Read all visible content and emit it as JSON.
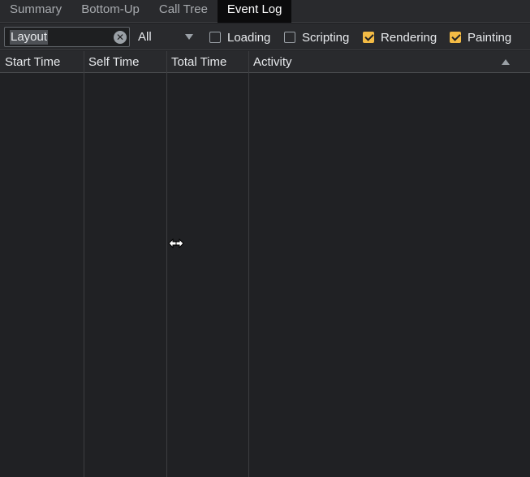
{
  "tabs": [
    {
      "label": "Summary"
    },
    {
      "label": "Bottom-Up"
    },
    {
      "label": "Call Tree"
    },
    {
      "label": "Event Log"
    }
  ],
  "active_tab": "Event Log",
  "toolbar": {
    "filter_value": "Layout",
    "duration_select": "All",
    "checkboxes": [
      {
        "label": "Loading",
        "checked": false
      },
      {
        "label": "Scripting",
        "checked": false
      },
      {
        "label": "Rendering",
        "checked": true
      },
      {
        "label": "Painting",
        "checked": true
      }
    ]
  },
  "grid": {
    "columns": [
      {
        "label": "Start Time"
      },
      {
        "label": "Self Time"
      },
      {
        "label": "Total Time"
      },
      {
        "label": "Activity"
      }
    ],
    "sort_column": "Activity",
    "sort_direction": "ascending",
    "rows": []
  },
  "colors": {
    "background": "#202124",
    "toolbar": "#292a2d",
    "active_tab": "#0b0b0c",
    "checkbox_checked": "#f3bb45"
  },
  "icons": {
    "clear": "clear-icon",
    "dropdown": "chevron-down-icon",
    "sort": "sort-ascending-icon",
    "cursor": "resize-horizontal-cursor-icon"
  }
}
